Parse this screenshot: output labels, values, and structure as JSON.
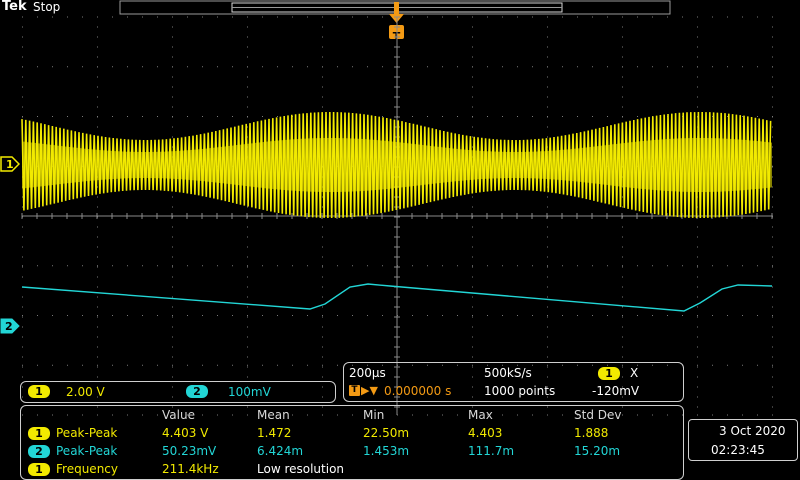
{
  "header": {
    "brand": "Tek",
    "acq_state": "Stop"
  },
  "trigger_marker": {
    "label": "T"
  },
  "channels": {
    "ch1": {
      "id": "1",
      "color": "#f2ea00",
      "scale": "2.00 V"
    },
    "ch2": {
      "id": "2",
      "color": "#22d6d6",
      "scale": "100mV"
    }
  },
  "timebase": {
    "horizontal_scale": "200µs",
    "sample_rate": "500kS/s",
    "trigger_delay": "0.000000 s",
    "record_length": "1000 points",
    "trigger_source": "1",
    "trigger_slope_symbol": "X",
    "trigger_level": "-120mV"
  },
  "measurements": {
    "headers": [
      "Value",
      "Mean",
      "Min",
      "Max",
      "Std Dev"
    ],
    "rows": [
      {
        "ch": "1",
        "name": "Peak-Peak",
        "value": "4.403 V",
        "mean": "1.472",
        "min": "22.50m",
        "max": "4.403",
        "std": "1.888"
      },
      {
        "ch": "2",
        "name": "Peak-Peak",
        "value": "50.23mV",
        "mean": "6.424m",
        "min": "1.453m",
        "max": "111.7m",
        "std": "15.20m"
      },
      {
        "ch": "1",
        "name": "Frequency",
        "value": "211.4kHz",
        "note": "Low resolution"
      }
    ]
  },
  "datetime": {
    "date": "3 Oct  2020",
    "time": "02:23:45"
  }
}
